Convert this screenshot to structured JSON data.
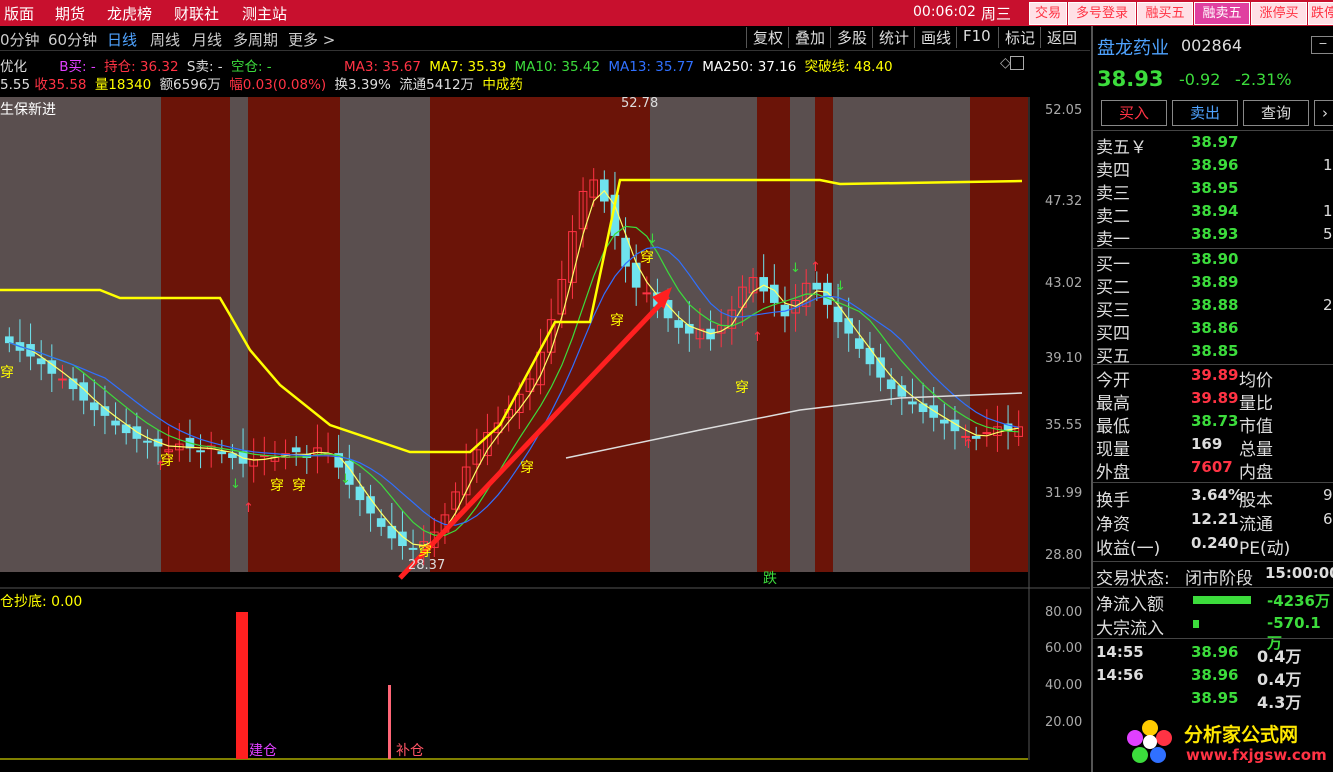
{
  "menu": [
    "版面",
    "期货",
    "龙虎榜",
    "财联社",
    "测主站"
  ],
  "clock": "00:06:02",
  "weekday": "周三",
  "top_buttons": [
    "交易",
    "多号登录",
    "融买五",
    "融卖五",
    "涨停买",
    "跌停"
  ],
  "periods": [
    "0分钟",
    "60分钟",
    "日线",
    "周线",
    "月线",
    "多周期",
    "更多 >"
  ],
  "active_period": "日线",
  "right_tools": [
    "复权",
    "叠加",
    "多股",
    "统计",
    "画线",
    "F10",
    "标记",
    "返回"
  ],
  "indicator_row1": {
    "prefix": "优化",
    "b_buy": "B买: -",
    "hold": "持仓: 36.32",
    "s_sell": "S卖: -",
    "empty": "空仓: -",
    "ma3": "MA3: 35.67",
    "ma7": "MA7: 35.39",
    "ma10": "MA10: 35.42",
    "ma13": "MA13: 35.77",
    "ma250": "MA250: 37.16",
    "breakout": "突破线: 48.40"
  },
  "indicator_row2": {
    "open": "5.55",
    "close": "收35.58",
    "volume": "量18340",
    "amount": "额6596万",
    "amplitude": "幅0.03(0.08%)",
    "turnover": "换3.39%",
    "float": "流通5412万",
    "industry": "中成药"
  },
  "chart_title": "生保新进",
  "y_axis_ticks": [
    "52.05",
    "47.32",
    "43.02",
    "39.10",
    "35.55",
    "31.99",
    "28.80"
  ],
  "peak_label": "52.78",
  "low_label": "28.37",
  "marker_chars": {
    "chuan": "穿",
    "die": "跌"
  },
  "sub_title": "仓抄底: 0.00",
  "sub_y_ticks": [
    "80.00",
    "60.00",
    "40.00",
    "20.00"
  ],
  "sub_labels": {
    "jian": "建仓",
    "bu": "补仓"
  },
  "stock": {
    "name": "盘龙药业",
    "code": "002864",
    "price": "38.93",
    "change": "-0.92",
    "pct": "-2.31%"
  },
  "action_buttons": [
    "买入",
    "卖出",
    "查询"
  ],
  "asks": [
    {
      "label": "卖五￥",
      "price": "38.97",
      "vol": ""
    },
    {
      "label": "卖四",
      "price": "38.96",
      "vol": "1"
    },
    {
      "label": "卖三",
      "price": "38.95",
      "vol": ""
    },
    {
      "label": "卖二",
      "price": "38.94",
      "vol": "1"
    },
    {
      "label": "卖一",
      "price": "38.93",
      "vol": "5"
    }
  ],
  "bids": [
    {
      "label": "买一",
      "price": "38.90",
      "vol": ""
    },
    {
      "label": "买二",
      "price": "38.89",
      "vol": ""
    },
    {
      "label": "买三",
      "price": "38.88",
      "vol": "2"
    },
    {
      "label": "买四",
      "price": "38.86",
      "vol": ""
    },
    {
      "label": "买五",
      "price": "38.85",
      "vol": ""
    }
  ],
  "stats": [
    {
      "l1": "今开",
      "v1": "39.89",
      "l2": "均价",
      "c": "#ff3344"
    },
    {
      "l1": "最高",
      "v1": "39.89",
      "l2": "量比",
      "c": "#ff3344"
    },
    {
      "l1": "最低",
      "v1": "38.73",
      "l2": "市值",
      "c": "#3cdc3c"
    },
    {
      "l1": "现量",
      "v1": "169",
      "l2": "总量",
      "c": "#ddd"
    },
    {
      "l1": "外盘",
      "v1": "7607",
      "l2": "内盘",
      "c": "#ff3344"
    }
  ],
  "stats2": [
    {
      "l1": "换手",
      "v1": "3.64%",
      "l2": "股本",
      "v2": "9"
    },
    {
      "l1": "净资",
      "v1": "12.21",
      "l2": "流通",
      "v2": "6"
    },
    {
      "l1": "收益(一)",
      "v1": "0.240",
      "l2": "PE(动)",
      "v2": ""
    }
  ],
  "trade_status": {
    "label": "交易状态:",
    "value": "闭市阶段",
    "time": "15:00:00"
  },
  "flows": [
    {
      "label": "净流入额",
      "value": "-4236万"
    },
    {
      "label": "大宗流入",
      "value": "-570.1万"
    }
  ],
  "ticks": [
    {
      "time": "14:55",
      "price": "38.96",
      "vol": "0.4万"
    },
    {
      "time": "14:56",
      "price": "38.96",
      "vol": "0.4万"
    },
    {
      "time": "",
      "price": "38.95",
      "vol": "4.3万"
    }
  ],
  "watermark": {
    "title": "分析家公式网",
    "url": "www.fxjgsw.com"
  },
  "colors": {
    "up": "#ff3344",
    "down": "#3cdc3c",
    "ma_yellow": "#ffff00",
    "band": "#6b1408",
    "gray": "#5a4f4f"
  }
}
